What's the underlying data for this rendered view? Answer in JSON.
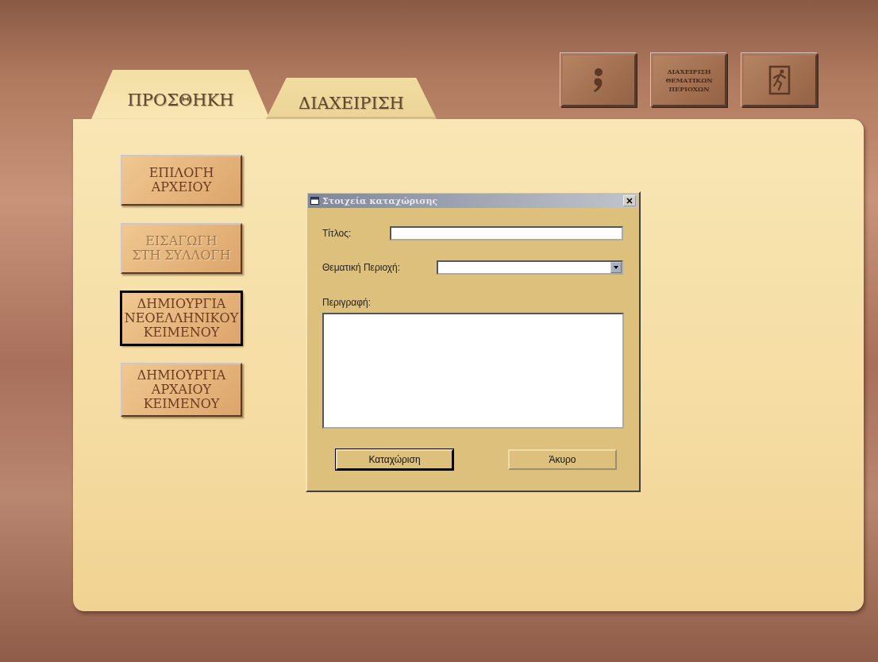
{
  "toolbar": [
    {
      "kind": "comma"
    },
    {
      "kind": "text",
      "label": "ΔΙΑΧΕΙΡΙΣΗ\nΘΕΜΑΤΙΚΩΝ\nΠΕΡΙΟΧΩΝ"
    },
    {
      "kind": "exit"
    }
  ],
  "tabs": [
    {
      "label": "ΠΡΟΣΘΗΚΗ",
      "selected": true
    },
    {
      "label": "ΔΙΑΧΕΙΡΙΣΗ",
      "selected": false
    }
  ],
  "actions": [
    {
      "label": "ΕΠΙΛΟΓΗ\nΑΡΧΕΙΟΥ",
      "disabled": false,
      "focused": false
    },
    {
      "label": "ΕΙΣΑΓΩΓΗ\nΣΤΗ ΣΥΛΛΟΓΗ",
      "disabled": true,
      "focused": false
    },
    {
      "label": "ΔΗΜΙΟΥΡΓΙΑ\nΝΕΟΕΛΛΗΝΙΚΟΥ\nΚΕΙΜΕΝΟΥ",
      "disabled": false,
      "focused": true
    },
    {
      "label": "ΔΗΜΙΟΥΡΓΙΑ\nΑΡΧΑΙΟΥ\nΚΕΙΜΕΝΟΥ",
      "disabled": false,
      "focused": false
    }
  ],
  "dialog": {
    "title": "Στοιχεία καταχώρισης",
    "title_label": "Τίτλος:",
    "category_label": "Θεματική Περιοχή:",
    "description_label": "Περιγραφή:",
    "buttons": [
      {
        "label": "Καταχώριση",
        "default": true
      },
      {
        "label": "Άκυρο",
        "default": false
      }
    ]
  }
}
